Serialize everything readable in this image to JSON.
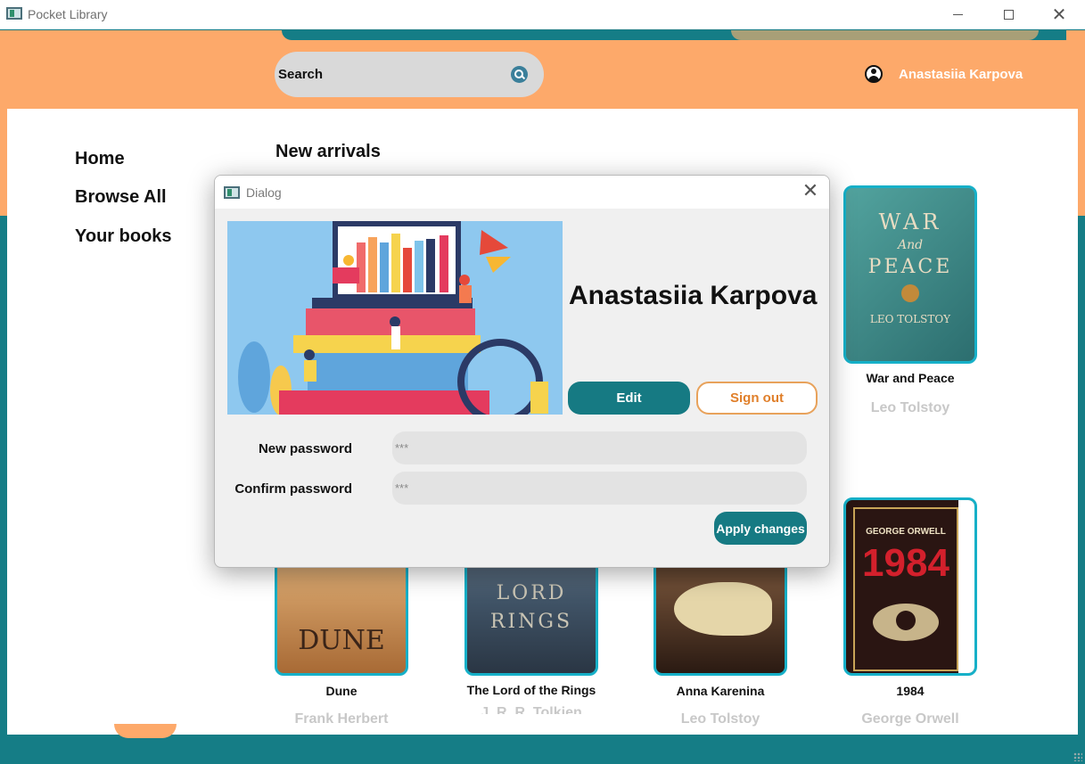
{
  "window": {
    "title": "Pocket Library"
  },
  "header": {
    "search_label": "Search",
    "user_name": "Anastasiia Karpova"
  },
  "sidebar": {
    "items": [
      {
        "label": "Home"
      },
      {
        "label": "Browse All"
      },
      {
        "label": "Your books"
      }
    ]
  },
  "main": {
    "section_title": "New arrivals",
    "books": [
      {
        "title": "War and Peace",
        "author": "Leo Tolstoy"
      },
      {
        "title": "Dune",
        "author": "Frank Herbert"
      },
      {
        "title": "The Lord of the Rings",
        "author": "J. R. R. Tolkien"
      },
      {
        "title": "Anna Karenina",
        "author": "Leo Tolstoy"
      },
      {
        "title": "1984",
        "author": "George Orwell"
      }
    ],
    "covers": {
      "war_and_peace": {
        "line1": "WAR",
        "line2": "And",
        "line3": "PEACE",
        "line4": "LEO TOLSTOY"
      },
      "dune": {
        "line1": "DUNE"
      },
      "lotr": {
        "line1": "LORD",
        "line2": "RINGS"
      },
      "nineteen84": {
        "line1": "GEORGE ORWELL",
        "line2": "1984"
      }
    }
  },
  "dialog": {
    "title": "Dialog",
    "profile_name": "Anastasiia Karpova",
    "edit_label": "Edit",
    "signout_label": "Sign out",
    "new_password_label": "New password",
    "new_password_placeholder": "***",
    "confirm_password_label": "Confirm password",
    "confirm_password_placeholder": "***",
    "apply_label": "Apply changes"
  },
  "colors": {
    "teal": "#157d86",
    "orange": "#fda96a",
    "accent_border": "#16b0c8",
    "signout": "#e07f2a"
  }
}
